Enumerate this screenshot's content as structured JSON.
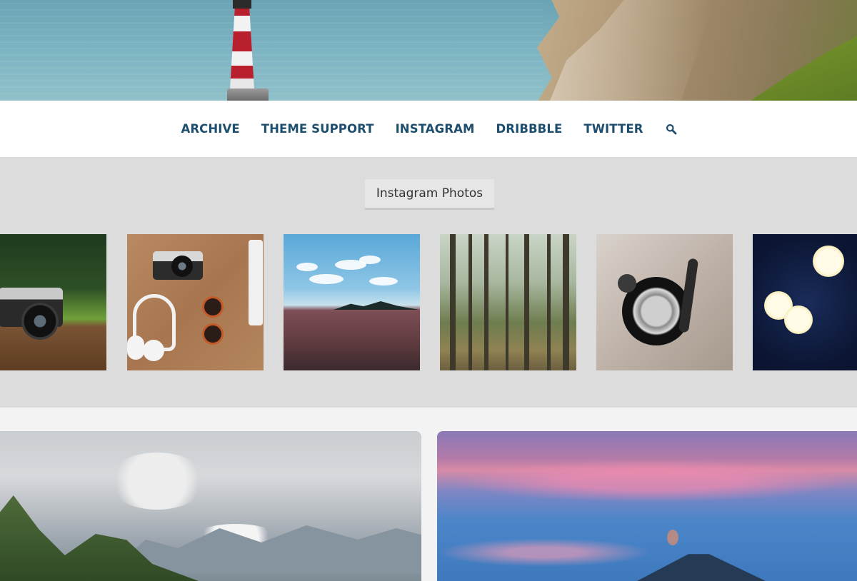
{
  "nav": {
    "items": [
      {
        "label": "ARCHIVE"
      },
      {
        "label": "THEME SUPPORT"
      },
      {
        "label": "INSTAGRAM"
      },
      {
        "label": "DRIBBBLE"
      },
      {
        "label": "TWITTER"
      }
    ],
    "search_icon": "search-icon"
  },
  "instagram": {
    "title": "Instagram Photos",
    "photos": [
      {
        "subject": "camera-on-wood"
      },
      {
        "subject": "flatlay-camera-headphones-sunglasses"
      },
      {
        "subject": "sea-horizon-clouds"
      },
      {
        "subject": "forest"
      },
      {
        "subject": "record-player"
      },
      {
        "subject": "bokeh-lights"
      }
    ]
  },
  "posts": [
    {
      "image": "mountain-range-clouds"
    },
    {
      "image": "sunset-volcano"
    }
  ],
  "colors": {
    "nav_text": "#1e4e6e",
    "band_bg": "#dcdcdc",
    "page_bg": "#f3f3f3"
  }
}
